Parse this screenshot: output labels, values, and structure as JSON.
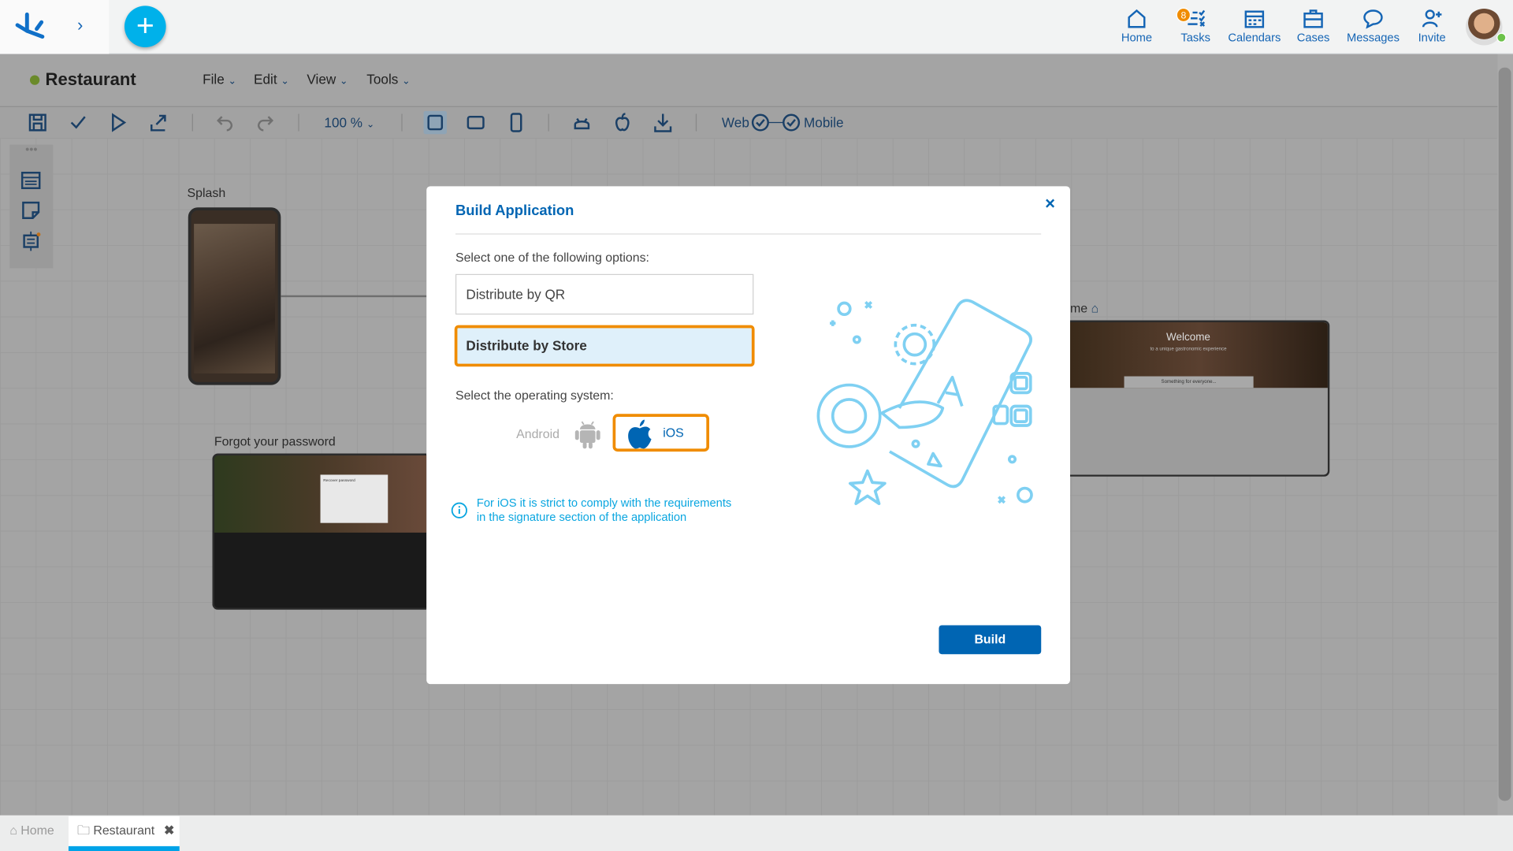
{
  "header": {
    "nav": [
      {
        "label": "Home",
        "icon": "home-icon"
      },
      {
        "label": "Tasks",
        "icon": "tasks-icon",
        "badge": "8"
      },
      {
        "label": "Calendars",
        "icon": "calendar-icon"
      },
      {
        "label": "Cases",
        "icon": "briefcase-icon"
      },
      {
        "label": "Messages",
        "icon": "chat-icon"
      },
      {
        "label": "Invite",
        "icon": "invite-user-icon"
      }
    ]
  },
  "project": {
    "title": "Restaurant",
    "status_color": "#6a8a2a",
    "menus": [
      "File",
      "Edit",
      "View",
      "Tools"
    ]
  },
  "toolbar": {
    "zoom": "100 %",
    "web_label": "Web",
    "mobile_label": "Mobile"
  },
  "canvas": {
    "splash_label": "Splash",
    "forgot_label": "Forgot your password",
    "home_label": "me",
    "home_preview": {
      "welcome": "Welcome",
      "subtitle": "to a unique gastronomic experience",
      "section": "Something for everyone..."
    },
    "forgot_preview": {
      "box_title": "Recover password"
    }
  },
  "dialog": {
    "title": "Build Application",
    "options_label": "Select one of the following options:",
    "options": [
      "Distribute by QR",
      "Distribute by Store"
    ],
    "selected_option": "Distribute by Store",
    "os_label": "Select the operating system:",
    "os": {
      "android": "Android",
      "ios": "iOS",
      "selected": "iOS"
    },
    "info": [
      "For iOS it is strict to comply with the requirements",
      "in the signature section of the application"
    ],
    "build_label": "Build",
    "accent": "#0065b3",
    "highlight": "#f08c00"
  },
  "tabs": [
    {
      "label": "Home"
    },
    {
      "label": "Restaurant",
      "active": true
    }
  ]
}
